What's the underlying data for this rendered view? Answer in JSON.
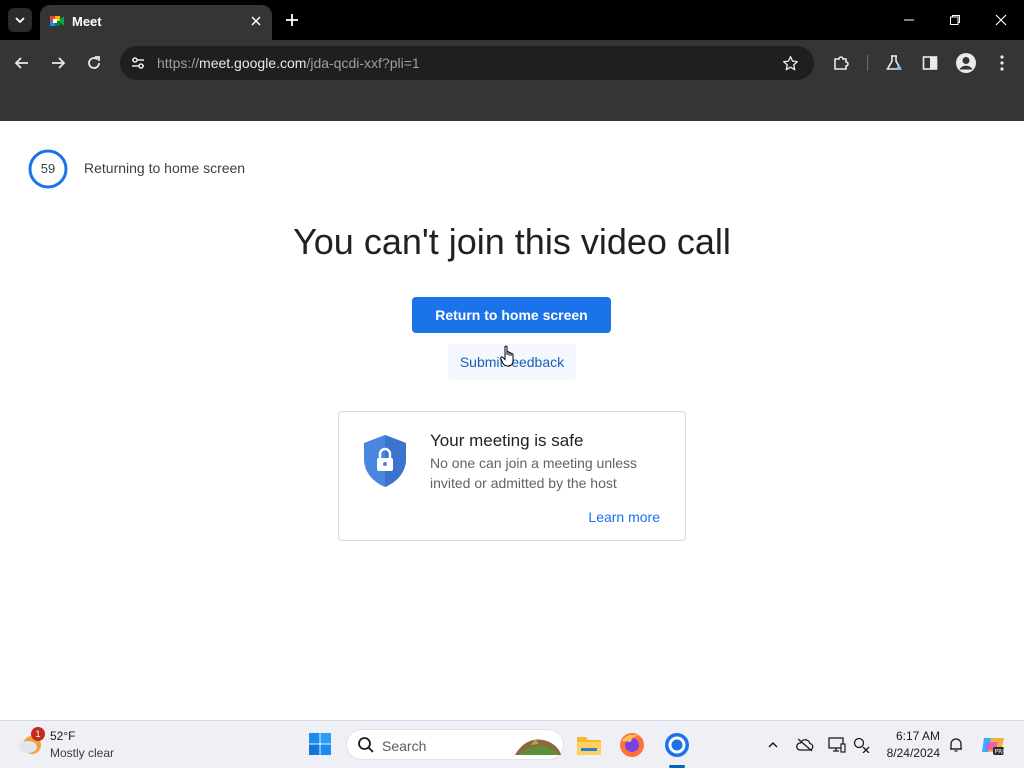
{
  "browser": {
    "tab_title": "Meet",
    "url_prefix": "https://",
    "url_host": "meet.google.com",
    "url_path": "/jda-qcdi-xxf?pli=1",
    "icons": {
      "tab_search": "chevron-down-icon",
      "favicon": "google-meet-icon",
      "tab_close": "close-icon",
      "new_tab": "plus-icon",
      "back": "back-arrow-icon",
      "forward": "forward-arrow-icon",
      "reload": "reload-icon",
      "site_info": "tune-icon",
      "bookmark": "star-icon",
      "extensions": "puzzle-icon",
      "labs": "flask-icon",
      "side_panel": "side-panel-icon",
      "profile": "profile-icon",
      "menu": "kebab-menu-icon"
    }
  },
  "page": {
    "countdown_value": "59",
    "countdown_text": "Returning to home screen",
    "headline": "You can't join this video call",
    "primary_button": "Return to home screen",
    "feedback_link": "Submit feedback",
    "safe_card": {
      "title": "Your meeting is safe",
      "description": "No one can join a meeting unless invited or admitted by the host",
      "link": "Learn more"
    },
    "colors": {
      "accent": "#1a73e8",
      "shield": "#4a86e0"
    }
  },
  "taskbar": {
    "weather_temp": "52°F",
    "weather_desc": "Mostly clear",
    "weather_badge": "1",
    "search_label": "Search",
    "clock_time": "6:17 AM",
    "clock_date": "8/24/2024",
    "apps": [
      "start-icon",
      "file-explorer-icon",
      "firefox-icon",
      "chrome-icon"
    ],
    "tray": [
      "chevron-up-icon",
      "cloud-off-icon",
      "display-icon",
      "network-icon",
      "bell-icon",
      "copilot-icon"
    ]
  }
}
